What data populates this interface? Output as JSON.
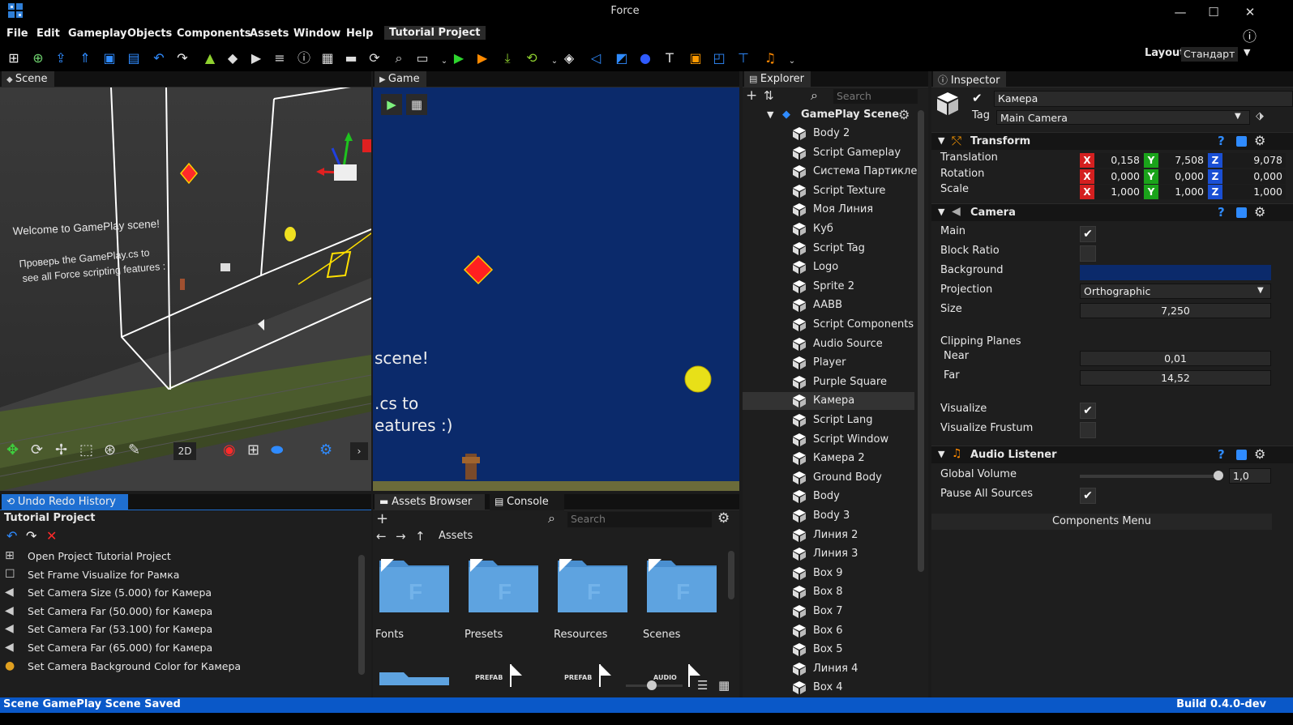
{
  "window": {
    "title": "Force",
    "minimize": "—",
    "maximize": "☐",
    "close": "✕",
    "info": "ⓘ"
  },
  "menu": {
    "items": [
      "File",
      "Edit",
      "Gameplay",
      "Objects",
      "Components",
      "Assets",
      "Window",
      "Help"
    ],
    "project": "Tutorial Project"
  },
  "layout": {
    "label": "Layout",
    "value": "Стандарт"
  },
  "scene_panel": {
    "tab": "Scene",
    "texts": {
      "welcome": "Welcome to GamePlay scene!",
      "line1": "Проверь the GamePlay.cs to",
      "line2": "see all Force scripting features :"
    },
    "btn_2d": "2D"
  },
  "game_panel": {
    "tab": "Game",
    "texts": {
      "t1": "scene!",
      "t2": ".cs to",
      "t3": "eatures :)"
    },
    "bg_color": "#0b2a6b"
  },
  "explorer": {
    "tab": "Explorer",
    "search_placeholder": "Search",
    "root": "GamePlay Scene",
    "items": [
      "Body 2",
      "Script Gameplay",
      "Система Партиклей",
      "Script Texture",
      "Моя Линия",
      "Куб",
      "Script Tag",
      "Logo",
      "Sprite 2",
      "AABB",
      "Script Components",
      "Audio Source",
      "Player",
      "Purple Square",
      "Камера",
      "Script Lang",
      "Script Window",
      "Камера 2",
      "Ground Body",
      "Body",
      "Body 3",
      "Линия 2",
      "Линия 3",
      "Box 9",
      "Box 8",
      "Box 7",
      "Box 6",
      "Box 5",
      "Линия 4",
      "Box 4"
    ],
    "selected": "Камера"
  },
  "inspector": {
    "tab": "Inspector",
    "name": "Камера",
    "tag_label": "Tag",
    "tag_value": "Main Camera",
    "transform": {
      "title": "Transform",
      "rows": [
        {
          "label": "Translation",
          "x": "0,158",
          "y": "7,508",
          "z": "9,078"
        },
        {
          "label": "Rotation",
          "x": "0,000",
          "y": "0,000",
          "z": "0,000"
        },
        {
          "label": "Scale",
          "x": "1,000",
          "y": "1,000",
          "z": "1,000"
        }
      ]
    },
    "camera": {
      "title": "Camera",
      "main": "Main",
      "block_ratio": "Block Ratio",
      "background": "Background",
      "background_color": "#0b2a6b",
      "projection": "Projection",
      "projection_value": "Orthographic",
      "size": "Size",
      "size_value": "7,250",
      "clipping": "Clipping Planes",
      "near": "Near",
      "near_value": "0,01",
      "far": "Far",
      "far_value": "14,52",
      "visualize": "Visualize",
      "visualize_frustum": "Visualize Frustum"
    },
    "audio": {
      "title": "Audio Listener",
      "global_volume": "Global Volume",
      "volume_value": "1,0",
      "volume_fraction": 0.97,
      "pause_all": "Pause All Sources"
    },
    "components_menu": "Components Menu",
    "axis_labels": {
      "x": "X",
      "y": "Y",
      "z": "Z"
    }
  },
  "history": {
    "tab": "Undo Redo History",
    "project": "Tutorial Project",
    "items": [
      "Open Project Tutorial Project",
      "Set Frame Visualize for Рамка",
      "Set Camera Size (5.000) for Камера",
      "Set Camera Far (50.000) for Камера",
      "Set Camera Far (53.100) for Камера",
      "Set Camera Far (65.000) for Камера",
      "Set Camera Background Color for Камера"
    ]
  },
  "assets": {
    "tab_browser": "Assets Browser",
    "tab_console": "Console",
    "search_placeholder": "Search",
    "path": "Assets",
    "folders": [
      "Fonts",
      "Presets",
      "Resources",
      "Scenes"
    ],
    "files": [
      "PREFAB",
      "PREFAB",
      "AUDIO"
    ]
  },
  "status": {
    "left": "Scene GamePlay Scene Saved",
    "right": "Build 0.4.0-dev"
  },
  "colors": {
    "accent": "#1f6fd1",
    "status_bar": "#0a58c8",
    "x_axis": "#d42020",
    "y_axis": "#1aa31a",
    "z_axis": "#1a4fd4"
  }
}
